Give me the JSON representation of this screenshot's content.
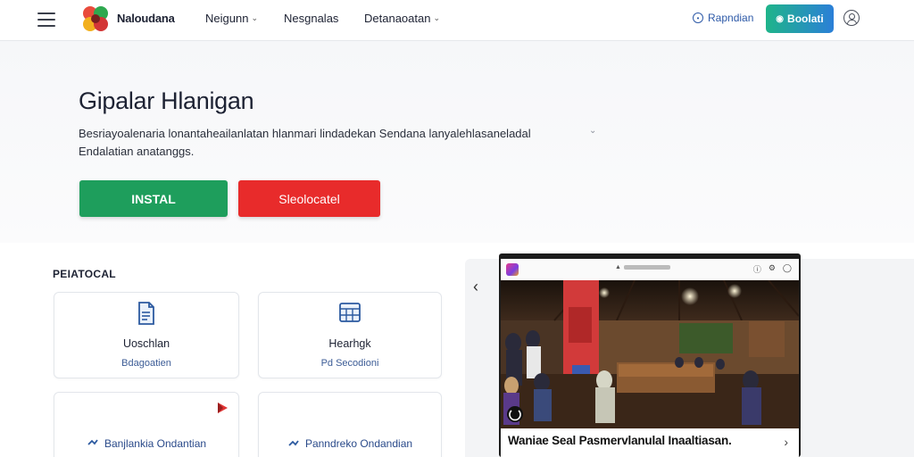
{
  "header": {
    "brand": "Naloudana",
    "nav": [
      {
        "label": "Neigunn",
        "has_dropdown": true
      },
      {
        "label": "Nesgnalas",
        "has_dropdown": false
      },
      {
        "label": "Detanaoatan",
        "has_dropdown": true
      }
    ],
    "signin_label": "Rapndian",
    "cta_label": "Boolati"
  },
  "hero": {
    "title": "Gipalar Hlanigan",
    "description": "Besriayoalenaria lonantaheailanlatan hlanmari lindadekan Sendana lanyalehlasaneladal Endalatian anatanggs.",
    "install_label": "INSTAL",
    "secondary_label": "Sleolocatel"
  },
  "section": {
    "label": "PEIATOCAL",
    "cards": [
      {
        "title": "Uoschlan",
        "subtitle": "Bdagoatien"
      },
      {
        "title": "Hearhgk",
        "subtitle": "Pd Secodioni"
      },
      {
        "link": "Banjlankia Ondantian"
      },
      {
        "link": "Panndreko Ondandian"
      }
    ]
  },
  "preview": {
    "caption": "Waniae Seal Pasmervlanulal Inaaltiasan."
  },
  "colors": {
    "install_green": "#1e9e5c",
    "secondary_red": "#e82b2b",
    "link_blue": "#2e5aa8"
  }
}
